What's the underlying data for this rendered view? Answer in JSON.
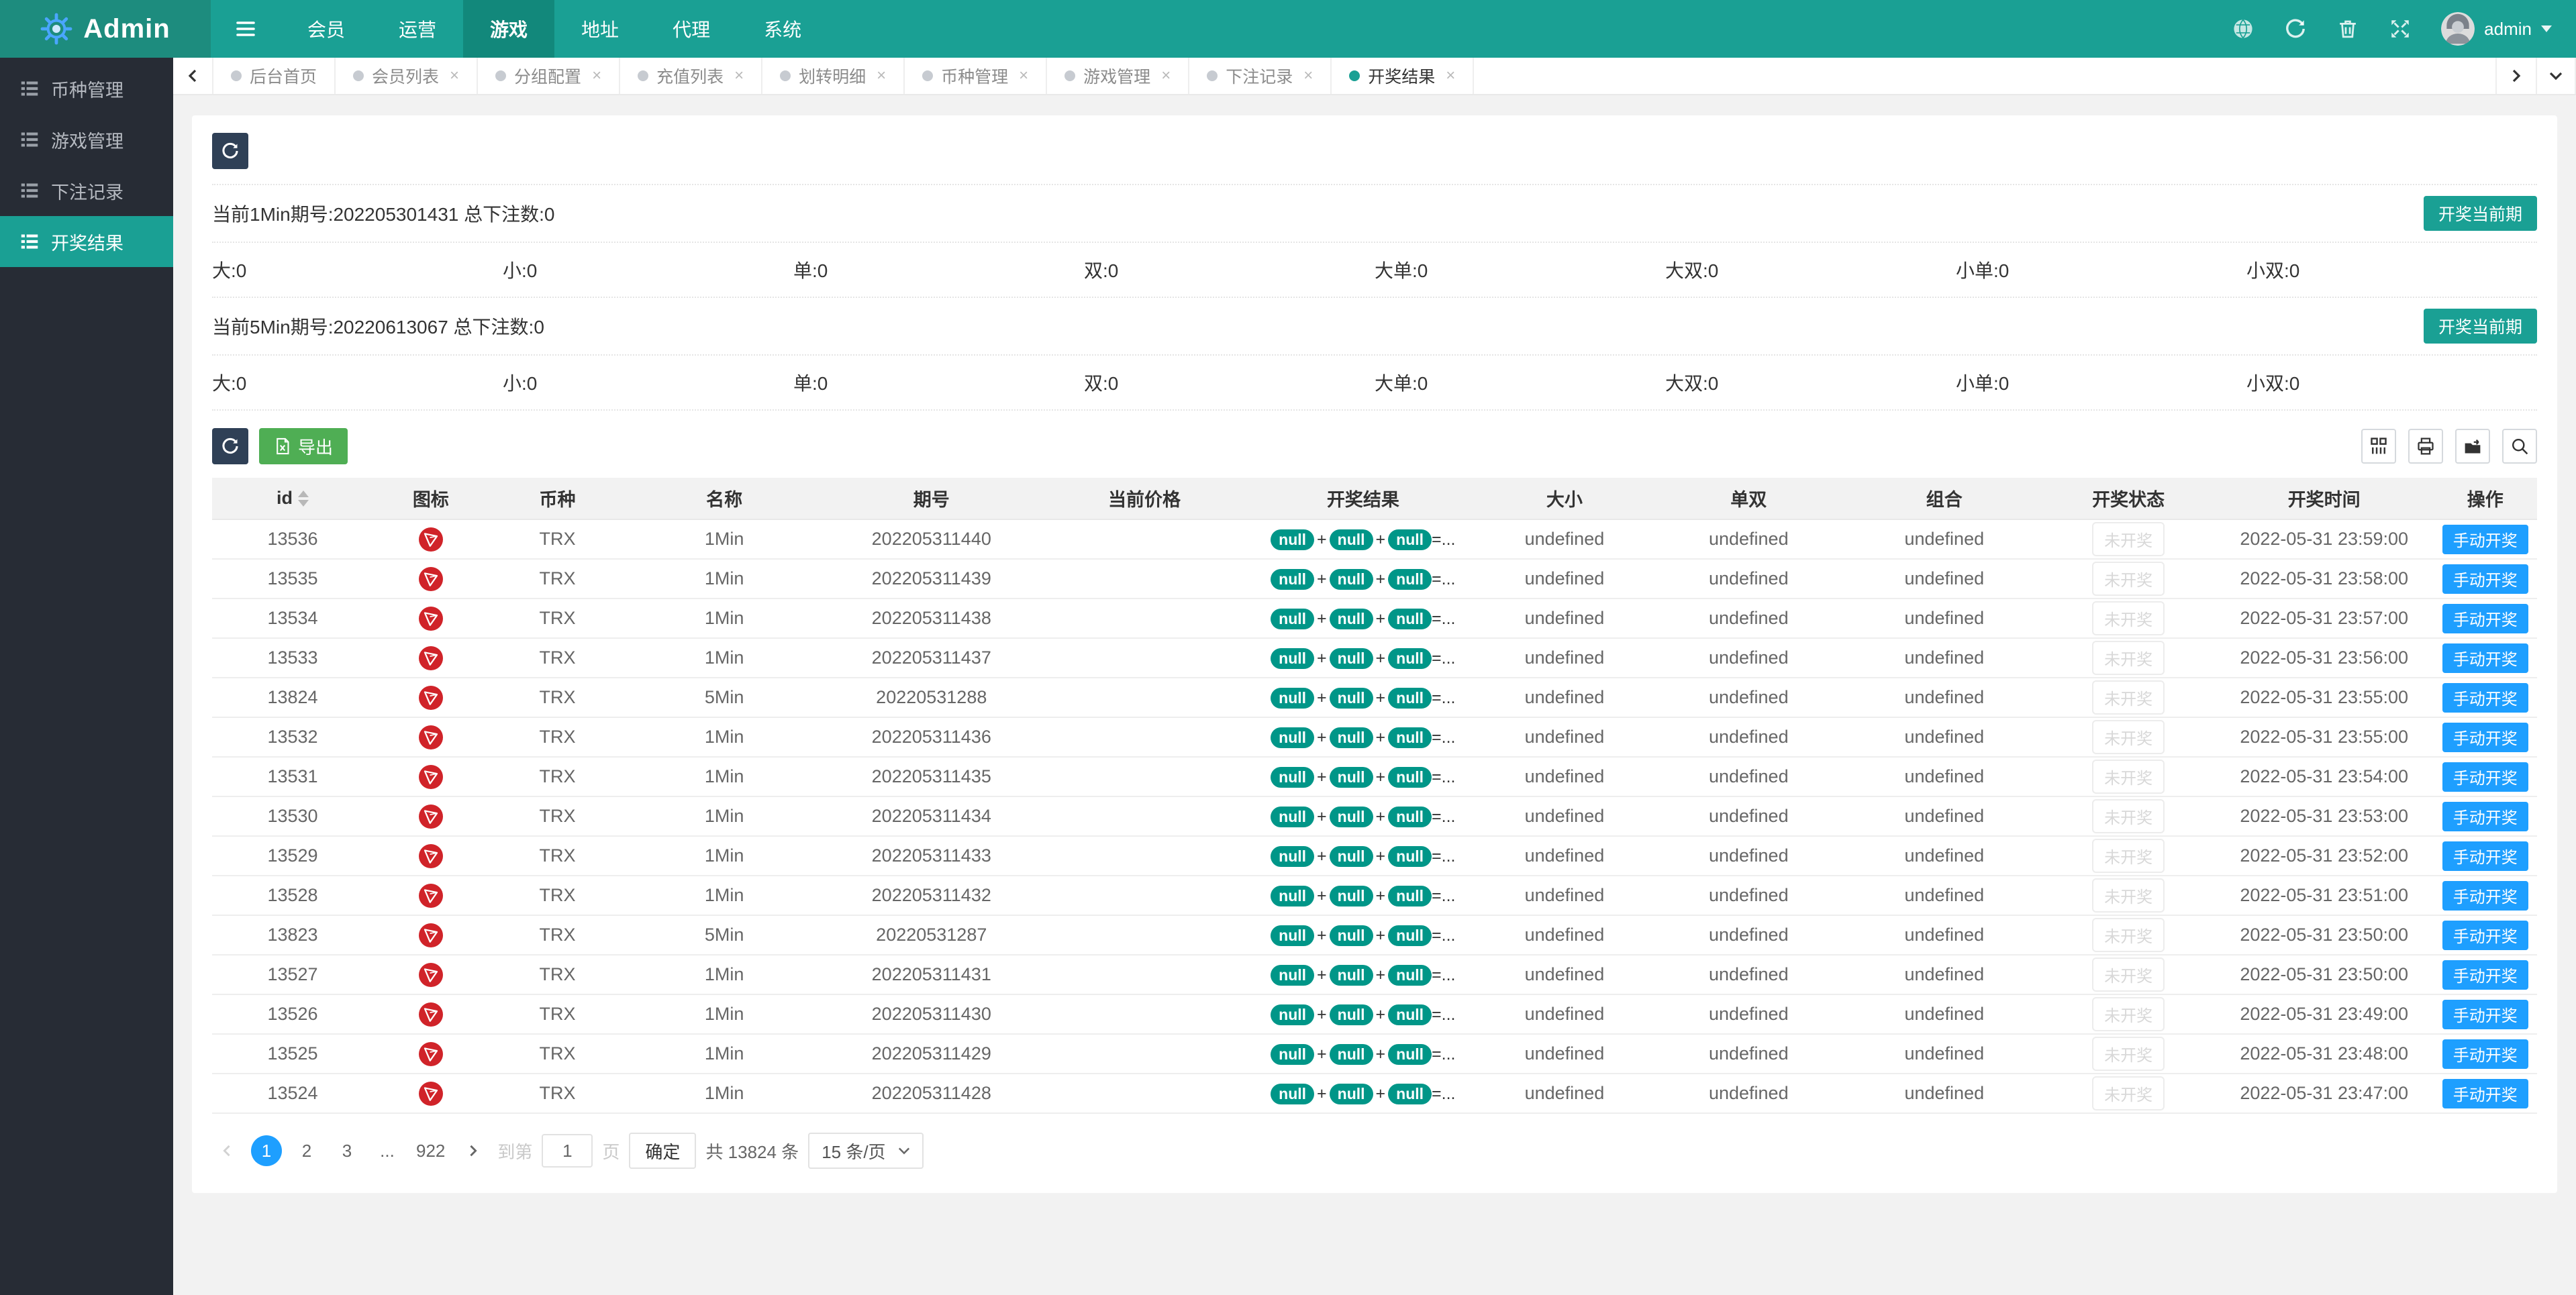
{
  "colors": {
    "theme_teal": "#1aa094",
    "logo_teal": "#1d8c7e",
    "nav_active_teal": "#12887b",
    "sidebar_dark": "#272c35",
    "button_dark": "#2f4056",
    "export_green": "#4fae54",
    "badge_teal": "#009688",
    "action_blue": "#1e9fff",
    "tron_red": "#d02329",
    "page_bg": "#f2f2f2"
  },
  "header": {
    "logo_text": "Admin",
    "nav": [
      {
        "label": "会员"
      },
      {
        "label": "运营"
      },
      {
        "label": "游戏",
        "active": true
      },
      {
        "label": "地址"
      },
      {
        "label": "代理"
      },
      {
        "label": "系统"
      }
    ],
    "icons": [
      "ball-icon",
      "refresh-icon",
      "trash-icon",
      "fullscreen-icon"
    ],
    "username": "admin"
  },
  "sidebar": {
    "items": [
      {
        "label": "币种管理"
      },
      {
        "label": "游戏管理"
      },
      {
        "label": "下注记录"
      },
      {
        "label": "开奖结果",
        "active": true
      }
    ]
  },
  "tabs": [
    {
      "label": "后台首页",
      "closable": false
    },
    {
      "label": "会员列表",
      "closable": true
    },
    {
      "label": "分组配置",
      "closable": true
    },
    {
      "label": "充值列表",
      "closable": true
    },
    {
      "label": "划转明细",
      "closable": true
    },
    {
      "label": "币种管理",
      "closable": true
    },
    {
      "label": "游戏管理",
      "closable": true
    },
    {
      "label": "下注记录",
      "closable": true
    },
    {
      "label": "开奖结果",
      "closable": true,
      "active": true
    }
  ],
  "tab_close_glyph": "×",
  "panel": {
    "sections": [
      {
        "title": "当前1Min期号:202205301431 总下注数:0",
        "action_label": "开奖当前期",
        "stats": [
          "大:0",
          "小:0",
          "单:0",
          "双:0",
          "大单:0",
          "大双:0",
          "小单:0",
          "小双:0"
        ]
      },
      {
        "title": "当前5Min期号:20220613067 总下注数:0",
        "action_label": "开奖当前期",
        "stats": [
          "大:0",
          "小:0",
          "单:0",
          "双:0",
          "大单:0",
          "大双:0",
          "小单:0",
          "小双:0"
        ]
      }
    ],
    "toolbar": {
      "export_label": "导出"
    },
    "table": {
      "columns": [
        {
          "label": "id",
          "sortable": true
        },
        {
          "label": "图标"
        },
        {
          "label": "币种"
        },
        {
          "label": "名称"
        },
        {
          "label": "期号"
        },
        {
          "label": "当前价格"
        },
        {
          "label": "开奖结果"
        },
        {
          "label": "大小"
        },
        {
          "label": "单双"
        },
        {
          "label": "组合"
        },
        {
          "label": "开奖状态"
        },
        {
          "label": "开奖时间"
        },
        {
          "label": "操作"
        }
      ],
      "result": {
        "badge": "null",
        "plus": "+",
        "eq": "=..."
      },
      "status_label": "未开奖",
      "action_label": "手动开奖",
      "rows": [
        {
          "id": "13536",
          "coin": "TRX",
          "name": "1Min",
          "issue": "202205311440",
          "price": "",
          "size": "undefined",
          "parity": "undefined",
          "combo": "undefined",
          "time": "2022-05-31 23:59:00"
        },
        {
          "id": "13535",
          "coin": "TRX",
          "name": "1Min",
          "issue": "202205311439",
          "price": "",
          "size": "undefined",
          "parity": "undefined",
          "combo": "undefined",
          "time": "2022-05-31 23:58:00"
        },
        {
          "id": "13534",
          "coin": "TRX",
          "name": "1Min",
          "issue": "202205311438",
          "price": "",
          "size": "undefined",
          "parity": "undefined",
          "combo": "undefined",
          "time": "2022-05-31 23:57:00"
        },
        {
          "id": "13533",
          "coin": "TRX",
          "name": "1Min",
          "issue": "202205311437",
          "price": "",
          "size": "undefined",
          "parity": "undefined",
          "combo": "undefined",
          "time": "2022-05-31 23:56:00"
        },
        {
          "id": "13824",
          "coin": "TRX",
          "name": "5Min",
          "issue": "20220531288",
          "price": "",
          "size": "undefined",
          "parity": "undefined",
          "combo": "undefined",
          "time": "2022-05-31 23:55:00"
        },
        {
          "id": "13532",
          "coin": "TRX",
          "name": "1Min",
          "issue": "202205311436",
          "price": "",
          "size": "undefined",
          "parity": "undefined",
          "combo": "undefined",
          "time": "2022-05-31 23:55:00"
        },
        {
          "id": "13531",
          "coin": "TRX",
          "name": "1Min",
          "issue": "202205311435",
          "price": "",
          "size": "undefined",
          "parity": "undefined",
          "combo": "undefined",
          "time": "2022-05-31 23:54:00"
        },
        {
          "id": "13530",
          "coin": "TRX",
          "name": "1Min",
          "issue": "202205311434",
          "price": "",
          "size": "undefined",
          "parity": "undefined",
          "combo": "undefined",
          "time": "2022-05-31 23:53:00"
        },
        {
          "id": "13529",
          "coin": "TRX",
          "name": "1Min",
          "issue": "202205311433",
          "price": "",
          "size": "undefined",
          "parity": "undefined",
          "combo": "undefined",
          "time": "2022-05-31 23:52:00"
        },
        {
          "id": "13528",
          "coin": "TRX",
          "name": "1Min",
          "issue": "202205311432",
          "price": "",
          "size": "undefined",
          "parity": "undefined",
          "combo": "undefined",
          "time": "2022-05-31 23:51:00"
        },
        {
          "id": "13823",
          "coin": "TRX",
          "name": "5Min",
          "issue": "20220531287",
          "price": "",
          "size": "undefined",
          "parity": "undefined",
          "combo": "undefined",
          "time": "2022-05-31 23:50:00"
        },
        {
          "id": "13527",
          "coin": "TRX",
          "name": "1Min",
          "issue": "202205311431",
          "price": "",
          "size": "undefined",
          "parity": "undefined",
          "combo": "undefined",
          "time": "2022-05-31 23:50:00"
        },
        {
          "id": "13526",
          "coin": "TRX",
          "name": "1Min",
          "issue": "202205311430",
          "price": "",
          "size": "undefined",
          "parity": "undefined",
          "combo": "undefined",
          "time": "2022-05-31 23:49:00"
        },
        {
          "id": "13525",
          "coin": "TRX",
          "name": "1Min",
          "issue": "202205311429",
          "price": "",
          "size": "undefined",
          "parity": "undefined",
          "combo": "undefined",
          "time": "2022-05-31 23:48:00"
        },
        {
          "id": "13524",
          "coin": "TRX",
          "name": "1Min",
          "issue": "202205311428",
          "price": "",
          "size": "undefined",
          "parity": "undefined",
          "combo": "undefined",
          "time": "2022-05-31 23:47:00"
        }
      ]
    },
    "pagination": {
      "pages": [
        {
          "label": "1",
          "active": true
        },
        {
          "label": "2"
        },
        {
          "label": "3"
        },
        {
          "label": "...",
          "dim": true
        },
        {
          "label": "922"
        }
      ],
      "jump_prefix": "到第",
      "jump_value": "1",
      "jump_suffix": "页",
      "confirm_label": "确定",
      "total_label": "共 13824 条",
      "per_page_label": "15 条/页"
    }
  }
}
